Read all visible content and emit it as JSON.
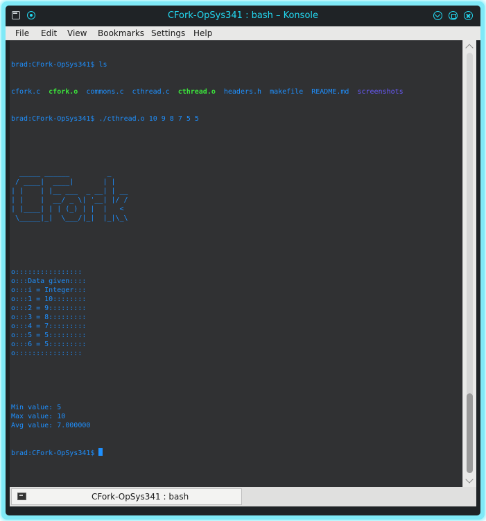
{
  "window": {
    "title": "CFork-OpSys341 : bash – Konsole",
    "accent": "#23d9f2"
  },
  "menu": {
    "items": [
      "File",
      "Edit",
      "View",
      "Bookmarks",
      "Settings",
      "Help"
    ]
  },
  "terminal": {
    "prompt": "brad:CFork-OpSys341$",
    "cmd1": "ls",
    "ls_files": [
      {
        "name": "cfork.c",
        "color": "blue"
      },
      {
        "name": "cfork.o",
        "color": "green"
      },
      {
        "name": "commons.c",
        "color": "blue"
      },
      {
        "name": "cthread.c",
        "color": "blue"
      },
      {
        "name": "cthread.o",
        "color": "green"
      },
      {
        "name": "headers.h",
        "color": "blue"
      },
      {
        "name": "makefile",
        "color": "blue"
      },
      {
        "name": "README.md",
        "color": "blue"
      },
      {
        "name": "screenshots",
        "color": "violet"
      }
    ],
    "cmd2": "./cthread.o 10 9 8 7 5 5",
    "banner": [
      "  _____ ______         _",
      " / ____|  ____|       | |",
      "| |    | |__ ___  _ __| | __",
      "| |    |  __/ _ \\| '__| |/ /",
      "| |____| | | (_) | |  |   <",
      " \\_____|_|  \\___/|_|  |_|\\_\\"
    ],
    "output": [
      "o::::::::::::::::",
      "o:::Data given::::",
      "o:::i = Integer:::",
      "o:::1 = 10::::::::",
      "o:::2 = 9:::::::::",
      "o:::3 = 8:::::::::",
      "o:::4 = 7:::::::::",
      "o:::5 = 5:::::::::",
      "o:::6 = 5:::::::::",
      "o::::::::::::::::"
    ],
    "results": [
      "Min value: 5",
      "Max value: 10",
      "Avg value: 7.000000"
    ],
    "colors": {
      "blue": "#1e90ff",
      "green": "#3be23b",
      "violet": "#6a5bff"
    }
  },
  "scrollbar": {
    "thumb_start_fraction": 0.81,
    "thumb_size_fraction": 0.19
  },
  "tab": {
    "label": "CFork-OpSys341 : bash"
  }
}
